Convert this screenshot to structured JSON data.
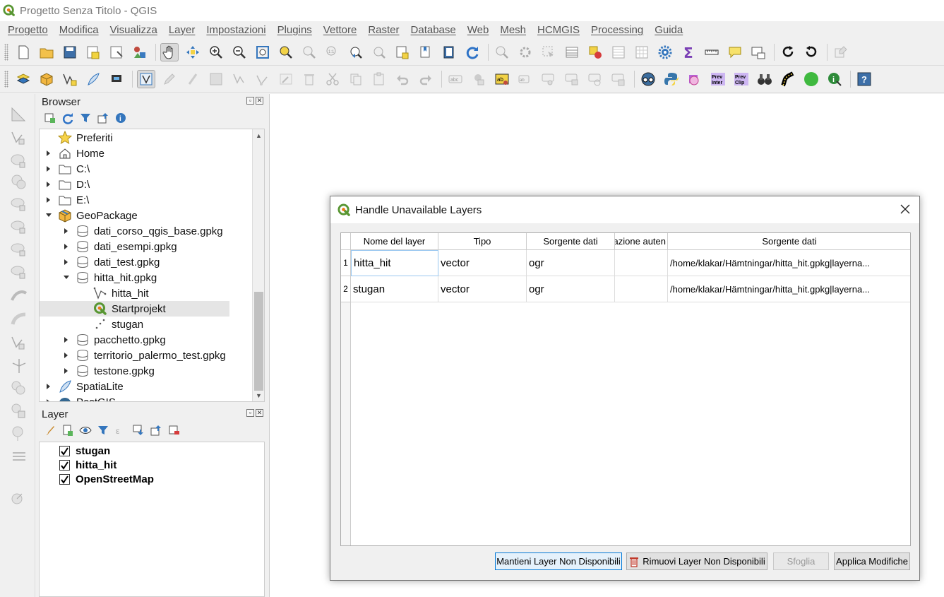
{
  "window": {
    "title": "Progetto Senza Titolo - QGIS"
  },
  "menu": [
    "Progetto",
    "Modifica",
    "Visualizza",
    "Layer",
    "Impostazioni",
    "Plugins",
    "Vettore",
    "Raster",
    "Database",
    "Web",
    "Mesh",
    "HCMGIS",
    "Processing",
    "Guida"
  ],
  "toolbar2_labels": {
    "prev_inter": "Prev Inter",
    "prev_clip": "Prev Clip"
  },
  "browser": {
    "title": "Browser",
    "items": [
      {
        "label": "Preferiti",
        "icon": "star-icon"
      },
      {
        "label": "Home",
        "icon": "home-icon"
      },
      {
        "label": "C:\\",
        "icon": "folder-icon"
      },
      {
        "label": "D:\\",
        "icon": "folder-icon"
      },
      {
        "label": "E:\\",
        "icon": "folder-icon"
      },
      {
        "label": "GeoPackage",
        "icon": "geopackage-icon"
      },
      {
        "label": "dati_corso_qgis_base.gpkg",
        "icon": "database-icon"
      },
      {
        "label": "dati_esempi.gpkg",
        "icon": "database-icon"
      },
      {
        "label": "dati_test.gpkg",
        "icon": "database-icon"
      },
      {
        "label": "hitta_hit.gpkg",
        "icon": "database-icon"
      },
      {
        "label": "hitta_hit",
        "icon": "line-layer-icon"
      },
      {
        "label": "Startprojekt",
        "icon": "qgis-project-icon"
      },
      {
        "label": "stugan",
        "icon": "point-layer-icon"
      },
      {
        "label": "pacchetto.gpkg",
        "icon": "database-icon"
      },
      {
        "label": "territorio_palermo_test.gpkg",
        "icon": "database-icon"
      },
      {
        "label": "testone.gpkg",
        "icon": "database-icon"
      },
      {
        "label": "SpatiaLite",
        "icon": "spatialite-icon"
      },
      {
        "label": "PostGIS",
        "icon": "postgis-icon"
      }
    ]
  },
  "layers": {
    "title": "Layer",
    "items": [
      {
        "label": "stugan",
        "checked": true
      },
      {
        "label": "hitta_hit",
        "checked": true
      },
      {
        "label": "OpenStreetMap",
        "checked": true
      }
    ]
  },
  "dialog": {
    "title": "Handle Unavailable Layers",
    "columns": [
      "Nome del layer",
      "Tipo",
      "Sorgente dati",
      "azione auten",
      "Sorgente dati"
    ],
    "rows": [
      {
        "num": "1",
        "name": "hitta_hit",
        "type": "vector",
        "provider": "ogr",
        "auth": "",
        "source": "/home/klakar/Hämtningar/hitta_hit.gpkg|layerna..."
      },
      {
        "num": "2",
        "name": "stugan",
        "type": "vector",
        "provider": "ogr",
        "auth": "",
        "source": "/home/klakar/Hämtningar/hitta_hit.gpkg|layerna..."
      }
    ],
    "buttons": {
      "keep": "Mantieni Layer Non Disponibili",
      "remove": "Rimuovi Layer Non Disponibili",
      "browse": "Sfoglia",
      "apply": "Applica Modifiche"
    }
  },
  "colors": {
    "qgis_green": "#589632",
    "selection": "#e5e5e5",
    "accent_blue": "#0078d7"
  }
}
